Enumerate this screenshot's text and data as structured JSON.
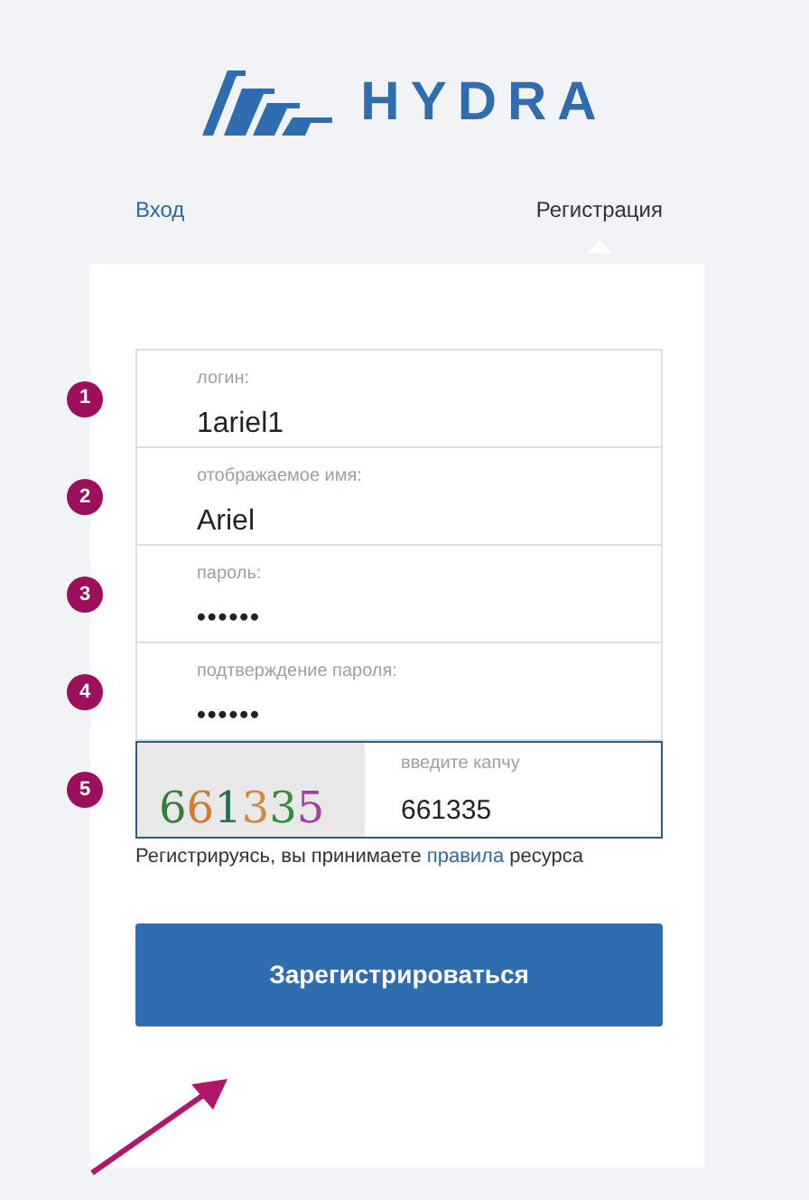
{
  "logo": {
    "text": "HYDRA"
  },
  "tabs": [
    {
      "label": "Вход",
      "selected": false
    },
    {
      "label": "Регистрация",
      "selected": true
    }
  ],
  "fields": [
    {
      "number": "1",
      "kind": "text",
      "label": "логин:",
      "value": "1ariel1"
    },
    {
      "number": "2",
      "kind": "text",
      "label": "отображаемое имя:",
      "value": "Ariel"
    },
    {
      "number": "3",
      "kind": "password",
      "label": "пароль:",
      "value": "••••••"
    },
    {
      "number": "4",
      "kind": "password",
      "label": "подтверждение пароля:",
      "value": "••••••"
    },
    {
      "number": "5",
      "kind": "captcha",
      "captcha_text": "661335",
      "label": "введите капчу",
      "value": "661335"
    }
  ],
  "terms": {
    "before": "Регистрируясь, вы принимаете",
    "link": "правила",
    "after": "ресурса"
  },
  "submit_button": "Зарегистрироваться"
}
